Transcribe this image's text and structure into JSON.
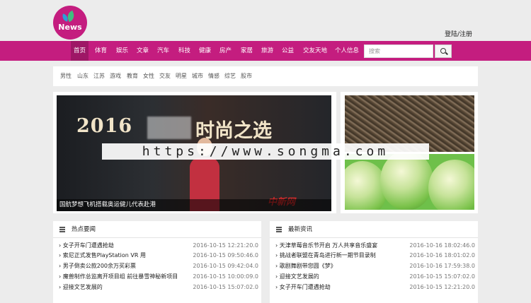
{
  "header": {
    "logo_text": "News",
    "login": "登陆/注册"
  },
  "nav": {
    "items": [
      "首页",
      "体育",
      "娱乐",
      "文章",
      "汽车",
      "科技",
      "健康",
      "房产",
      "家居",
      "旅游",
      "公益",
      "交友天地",
      "个人信息"
    ],
    "active_index": 0
  },
  "search": {
    "placeholder": "搜索"
  },
  "tags": [
    "男性",
    "山东",
    "江苏",
    "游戏",
    "教育",
    "女性",
    "交友",
    "明星",
    "城市",
    "情感",
    "综艺",
    "股市"
  ],
  "banner": {
    "title_left": "2016",
    "title_right": "时尚之选",
    "logo": "中新网",
    "caption": "国航梦想飞机搭载奥运健儿代表赴港"
  },
  "watermark": "https://www.songma.com",
  "panels": [
    {
      "title": "热点要闻",
      "rows": [
        {
          "title": "› 女子开车门遭遇抢劫",
          "date": "2016-10-15 12:21:20.0"
        },
        {
          "title": "› 索尼正式发售PlayStation VR 用",
          "date": "2016-10-15 09:50:46.0"
        },
        {
          "title": "› 男子倒卖公款200余万买彩票",
          "date": "2016-10-15 09:42:04.0"
        },
        {
          "title": "› 魔兽制作总监离开项目组 前往暴雪神秘新项目",
          "date": "2016-10-15 10:00:09.0"
        },
        {
          "title": "› 迎接文艺发展的",
          "date": "2016-10-15 15:07:02.0"
        }
      ]
    },
    {
      "title": "最新资讯",
      "rows": [
        {
          "title": "› 天津草莓音乐节开启 万人共享音乐盛宴",
          "date": "2016-10-16 18:02:46.0"
        },
        {
          "title": "› 挑战者联盟在青岛进行新一期节目录制",
          "date": "2016-10-16 18:01:02.0"
        },
        {
          "title": "› 歌剧舞剧带您圆《梦》",
          "date": "2016-10-16 17:59:38.0"
        },
        {
          "title": "› 迎接文艺发展的",
          "date": "2016-10-15 15:07:02.0"
        },
        {
          "title": "› 女子开车门遭遇抢劫",
          "date": "2016-10-15 12:21:20.0"
        }
      ]
    }
  ]
}
